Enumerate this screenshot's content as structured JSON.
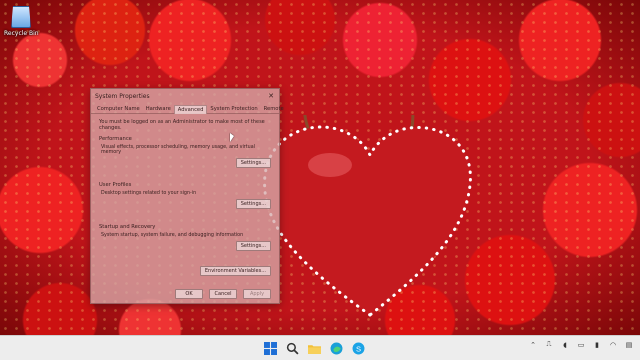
{
  "desktop": {
    "recycle_bin_label": "Recycle Bin"
  },
  "dialog": {
    "title": "System Properties",
    "close_glyph": "✕",
    "tabs": [
      {
        "label": "Computer Name"
      },
      {
        "label": "Hardware"
      },
      {
        "label": "Advanced"
      },
      {
        "label": "System Protection"
      },
      {
        "label": "Remote"
      }
    ],
    "active_tab": "Advanced",
    "admin_note": "You must be logged on as an Administrator to make most of these changes.",
    "performance": {
      "title": "Performance",
      "description": "Visual effects, processor scheduling, memory usage, and virtual memory",
      "button": "Settings..."
    },
    "user_profiles": {
      "title": "User Profiles",
      "description": "Desktop settings related to your sign-in",
      "button": "Settings..."
    },
    "startup_recovery": {
      "title": "Startup and Recovery",
      "description": "System startup, system failure, and debugging information",
      "button": "Settings..."
    },
    "env_button": "Environment Variables...",
    "ok": "OK",
    "cancel": "Cancel",
    "apply": "Apply"
  },
  "taskbar": {
    "icons": [
      "windows-start-icon",
      "search-icon",
      "file-explorer-icon",
      "edge-icon",
      "skype-icon"
    ],
    "tray": [
      "chevron-up-icon",
      "network-icon",
      "volume-icon",
      "camera-icon",
      "battery-icon",
      "wifi-icon",
      "notification-icon"
    ],
    "colors": {
      "start": "#1f6fd6",
      "folder": "#f2c037",
      "edge": "#1aa0d8",
      "skype": "#1ba3e6"
    }
  }
}
